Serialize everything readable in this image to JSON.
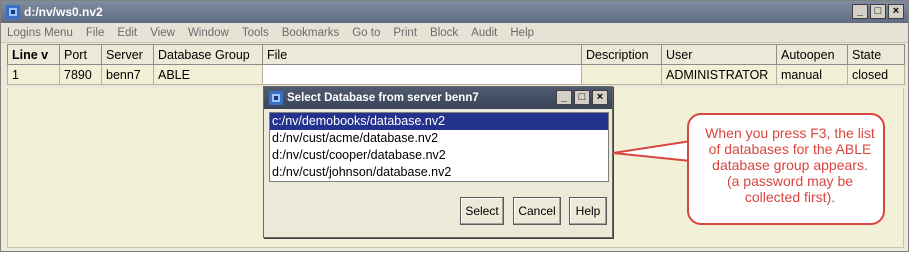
{
  "window": {
    "title": "d:/nv/ws0.nv2"
  },
  "window_controls": {
    "minimize": "_",
    "maximize": "□",
    "close": "×"
  },
  "menu": [
    "Logins Menu",
    "File",
    "Edit",
    "View",
    "Window",
    "Tools",
    "Bookmarks",
    "Go to",
    "Print",
    "Block",
    "Audit",
    "Help"
  ],
  "grid": {
    "headers": [
      "Line  v",
      "Port",
      "Server",
      "Database Group",
      "File",
      "Description",
      "User",
      "Autoopen",
      "State"
    ],
    "rows": [
      [
        "1",
        "7890",
        "benn7",
        "ABLE",
        "",
        "",
        "ADMINISTRATOR",
        "manual",
        "closed"
      ]
    ]
  },
  "dialog": {
    "title": "Select Database from server benn7",
    "items": [
      "c:/nv/demobooks/database.nv2",
      "d:/nv/cust/acme/database.nv2",
      "d:/nv/cust/cooper/database.nv2",
      "d:/nv/cust/johnson/database.nv2"
    ],
    "selected_index": 0,
    "buttons": {
      "select": "Select",
      "cancel": "Cancel",
      "help": "Help"
    }
  },
  "callout": {
    "text": "When you press F3, the list of databases for the ABLE database group appears. (a password may be collected first).",
    "color": "#d9453f"
  },
  "colors": {
    "selection": "#23328c",
    "row_background": "#f2f0d6"
  }
}
